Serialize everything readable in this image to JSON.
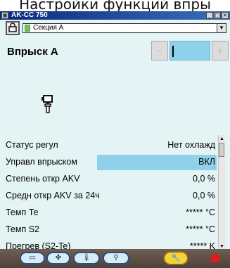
{
  "caption": "Настройки функций впры",
  "window": {
    "title": "AK-CC 750",
    "min_label": "_",
    "max_label": "□",
    "close_label": "×",
    "title_icon": "app-icon"
  },
  "section_select": {
    "value": "Секция А",
    "lock_icon": "lock-icon",
    "arrow": "▼"
  },
  "heading": "Впрыск А",
  "stepper": {
    "minus": "−",
    "plus": "+"
  },
  "rows": [
    {
      "label": "Статус регул",
      "value": "Нет охлажд"
    },
    {
      "label": "Управл впрыском",
      "value": "ВКЛ"
    },
    {
      "label": "Степень откр AKV",
      "value": "0,0 %"
    },
    {
      "label": "Средн откр AKV за 24ч",
      "value": "0,0 %"
    },
    {
      "label": "Темп Те",
      "value": "***** °C"
    },
    {
      "label": "Темп S2",
      "value": "***** °C"
    },
    {
      "label": "Прегрев (S2-Te)",
      "value": "***** K"
    }
  ],
  "scroll": {
    "up": "▲",
    "down": "▼"
  },
  "bottom_nav": {
    "btn1_icon": "compressor-icon",
    "btn2_icon": "fan-icon",
    "btn3_icon": "thermometer-icon",
    "btn4_icon": "valve-icon",
    "wrench_icon": "wrench-icon",
    "alarm_icon": "alarm-bell-icon"
  },
  "colors": {
    "background": "#e4f3f4",
    "highlight": "#8fd0ea",
    "bottom_bar": "#5f5047",
    "alarm": "#e11a1a",
    "wrench": "#f6d23a"
  }
}
